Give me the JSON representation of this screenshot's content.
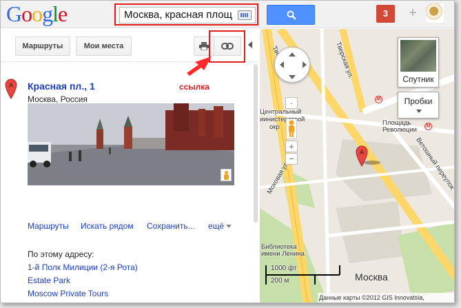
{
  "header": {
    "logo_letters": [
      "G",
      "o",
      "o",
      "g",
      "l",
      "e"
    ],
    "logo_colors": [
      "#3369e8",
      "#d50f25",
      "#eeb211",
      "#3369e8",
      "#009925",
      "#d50f25"
    ],
    "search_value": "Москва, красная площ",
    "notification_count": "3",
    "plus_label": "+"
  },
  "toolbar": {
    "routes_label": "Маршруты",
    "places_label": "Мои места",
    "annotation": "ссылка"
  },
  "place": {
    "title": "Красная пл., 1",
    "subtitle": "Москва, Россия",
    "marker_letter": "A",
    "actions": [
      "Маршруты",
      "Искать рядом",
      "Сохранить...",
      "ещё"
    ],
    "address_heading": "По этому адресу:",
    "address_links": [
      "1-й Полк Милиции (2-я Рота)",
      "Estate Park",
      "Moscow Private Tours"
    ]
  },
  "map": {
    "satellite_label": "Спутник",
    "traffic_label": "Пробки",
    "city_label": "Москва",
    "scale_ft": "1000 фт",
    "scale_m": "200 м",
    "copyright": "Данные карты ©2012 GIS Innovatsia, ",
    "marker_letter": "A",
    "zoom_in": "+",
    "zoom_out": "−",
    "labels": {
      "street_tverskaya": "Тверская",
      "street_tverskaya2": "Тверская ул.",
      "museum": "Центральный",
      "museum2": "иинистерствой",
      "museum3": "окр",
      "square_rev": "Площадь",
      "square_rev2": "Революции",
      "street_vetoshny": "Ветошный переулок",
      "street_mokhovaya": "Моховая ул.",
      "library": "Библиотека",
      "library2": "имени Ленина"
    }
  }
}
